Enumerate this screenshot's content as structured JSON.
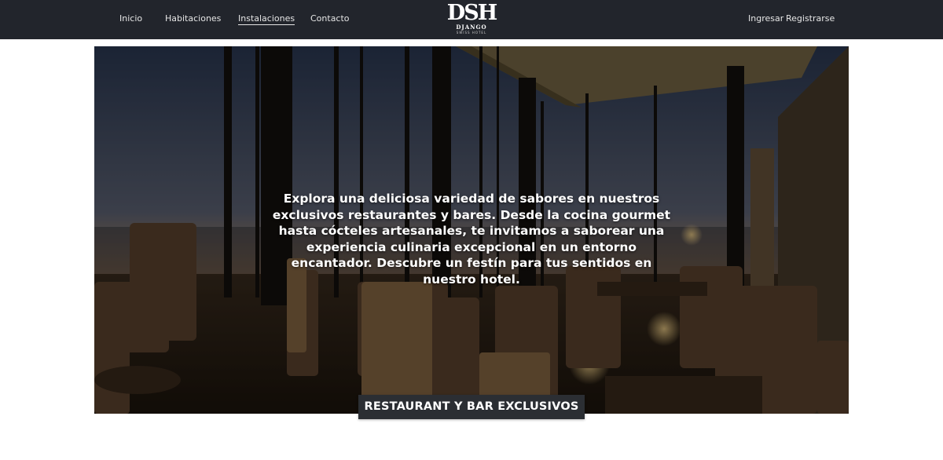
{
  "nav": {
    "left": [
      "Inicio",
      "Habitaciones",
      "Instalaciones",
      "Contacto"
    ],
    "active": "Instalaciones",
    "right": [
      "Ingresar",
      "Registrarse"
    ]
  },
  "logo": {
    "mark": "DSH",
    "name": "DJANGO",
    "tagline": "SWISS HOTEL"
  },
  "hero": {
    "description": "Explora una deliciosa variedad de sabores en nuestros exclusivos restaurantes y bares. Desde la cocina gourmet hasta cócteles artesanales, te invitamos a saborear una experiencia culinaria excepcional en un entorno encantador. Descubre un festín para tus sentidos en nuestro hotel.",
    "caption": "RESTAURANT Y BAR EXCLUSIVOS"
  },
  "colors": {
    "navbar": "#22252c",
    "caption_bg": "#2b2e33",
    "text_light": "#ffffff"
  }
}
